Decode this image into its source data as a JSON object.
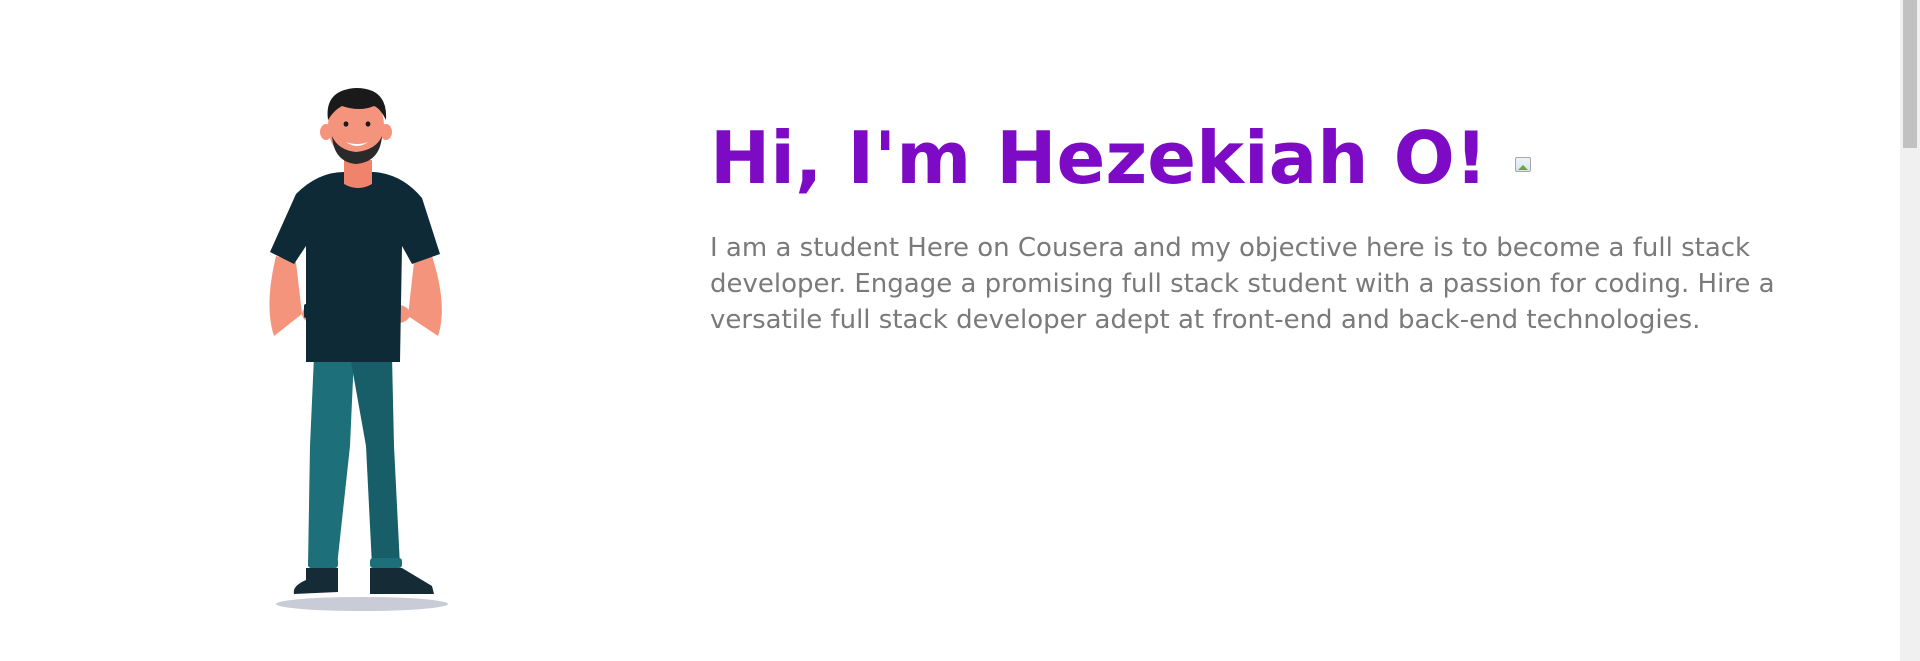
{
  "hero": {
    "greeting": "Hi, I'm Hezekiah O!",
    "bio": "I am a student Here on Cousera and my objective here is to become a full stack developer. Engage a promising full stack student with a passion for coding. Hire a versatile full stack developer adept at front-end and back-end technologies.",
    "illustration": "standing-man-illustration",
    "greeting_image": "broken-image-icon"
  },
  "colors": {
    "title": "#7d0bc6",
    "body_text": "#7a7a7a",
    "background": "#ffffff",
    "shirt": "#0e2a36",
    "pants": "#1d6f79",
    "skin": "#f5947c"
  }
}
